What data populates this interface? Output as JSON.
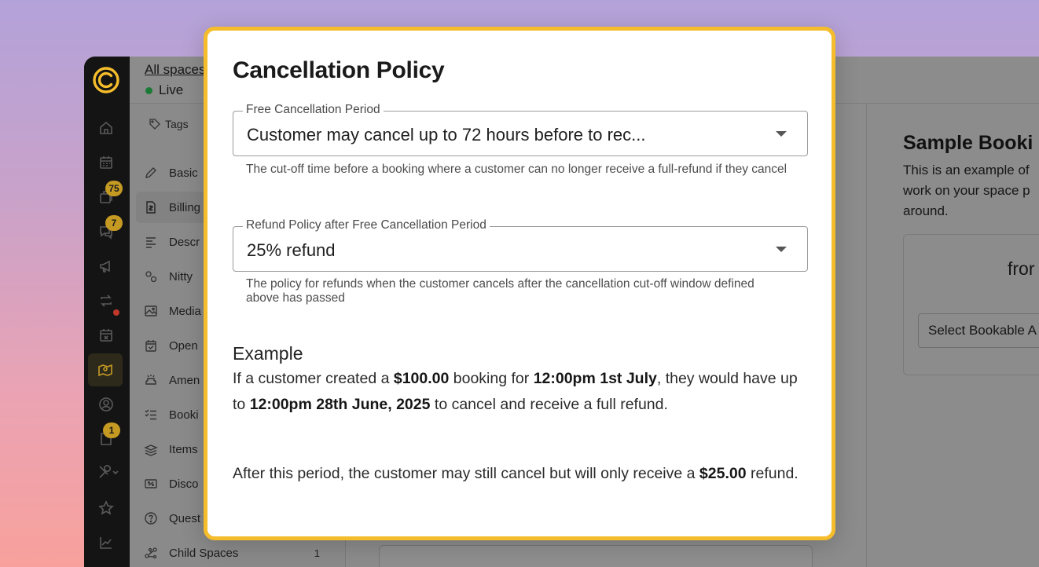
{
  "app": {
    "breadcrumb": "All spaces",
    "status": "Live",
    "rail_badges": {
      "bookings": "75",
      "messages": "7",
      "files": "1"
    },
    "tags_label": "Tags"
  },
  "subnav": {
    "items": [
      {
        "label": "Basic",
        "icon": "pencil-icon"
      },
      {
        "label": "Billing",
        "icon": "invoice-icon"
      },
      {
        "label": "Descr",
        "icon": "text-lines-icon"
      },
      {
        "label": "Nitty",
        "icon": "gears-icon"
      },
      {
        "label": "Media",
        "icon": "image-icon"
      },
      {
        "label": "Open",
        "icon": "calendar-check-icon"
      },
      {
        "label": "Amen",
        "icon": "sofa-icon"
      },
      {
        "label": "Booki",
        "icon": "checklist-icon"
      },
      {
        "label": "Items",
        "icon": "stack-icon"
      },
      {
        "label": "Disco",
        "icon": "ticket-icon"
      },
      {
        "label": "Quest",
        "icon": "question-icon"
      },
      {
        "label": "Child Spaces",
        "icon": "nodes-icon",
        "count": "1"
      }
    ]
  },
  "right_panel": {
    "title": "Sample Booki",
    "text": "This is an example of work on your space p around.",
    "from_label": "fror",
    "select_placeholder": "Select Bookable A"
  },
  "modal": {
    "title": "Cancellation Policy",
    "free_period": {
      "legend": "Free Cancellation Period",
      "value": "Customer may cancel up to 72 hours before to rec...",
      "help": "The cut-off time before a booking where a customer can no longer receive a full-refund if they cancel"
    },
    "refund_policy": {
      "legend": "Refund Policy after Free Cancellation Period",
      "value": "25% refund",
      "help": "The policy for refunds when the customer cancels after the cancellation cut-off window defined above has passed"
    },
    "example": {
      "heading": "Example",
      "p1_a": "If a customer created a ",
      "p1_amount": "$100.00",
      "p1_b": " booking for ",
      "p1_time": "12:00pm 1st July",
      "p1_c": ", they would have up to ",
      "p1_deadline": "12:00pm 28th June, 2025",
      "p1_d": " to cancel and receive a full refund.",
      "p2_a": "After this period, the customer may still cancel but will only receive a ",
      "p2_amount": "$25.00",
      "p2_b": " refund."
    }
  }
}
